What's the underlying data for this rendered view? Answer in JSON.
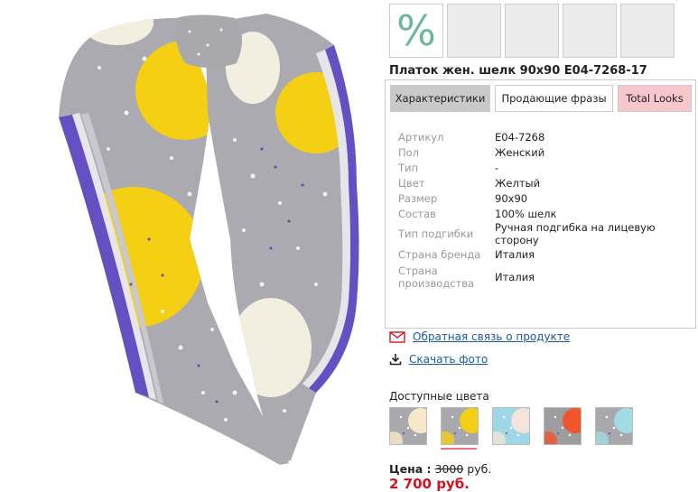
{
  "product": {
    "title": "Платок жен. шелк 90x90 E04-7268-17"
  },
  "thumbnails": [
    {
      "label": "%"
    },
    {
      "label": ""
    },
    {
      "label": ""
    },
    {
      "label": ""
    },
    {
      "label": ""
    }
  ],
  "tabs": [
    {
      "label": "Характеристики"
    },
    {
      "label": "Продающие фразы"
    },
    {
      "label": "Total Looks"
    }
  ],
  "specs": [
    {
      "key": "Артикул",
      "value": "E04-7268"
    },
    {
      "key": "Пол",
      "value": "Женский"
    },
    {
      "key": "Тип",
      "value": "-"
    },
    {
      "key": "Цвет",
      "value": "Желтый"
    },
    {
      "key": "Размер",
      "value": "90x90"
    },
    {
      "key": "Состав",
      "value": "100% шелк"
    },
    {
      "key": "Тип подгибки",
      "value": "Ручная подгибка на лицевую сторону"
    },
    {
      "key": "Страна бренда",
      "value": "Италия"
    },
    {
      "key": "Страна производства",
      "value": "Италия"
    }
  ],
  "links": {
    "feedback": "Обратная связь о продукте",
    "download": "Скачать фото"
  },
  "colors": {
    "label": "Доступные цвета",
    "swatches": [
      {
        "accent": "#f6e9c9",
        "base": "#a9a8ad"
      },
      {
        "accent": "#f5cf13",
        "base": "#a9a8ad"
      },
      {
        "accent": "#f3e3da",
        "base": "#9fd7e6"
      },
      {
        "accent": "#f0562c",
        "base": "#9d9c9f"
      },
      {
        "accent": "#a3dbe5",
        "base": "#a9a8ad"
      }
    ]
  },
  "price": {
    "label": "Цена :",
    "old": "3000",
    "currency": "руб.",
    "new": "2 700 руб."
  },
  "accent_colors": {
    "scarf_yellow": "#f5cf13",
    "scarf_grey": "#abaab0",
    "scarf_purple": "#6550c3",
    "price_red": "#d5131e",
    "link_blue": "#1a5aa8"
  }
}
